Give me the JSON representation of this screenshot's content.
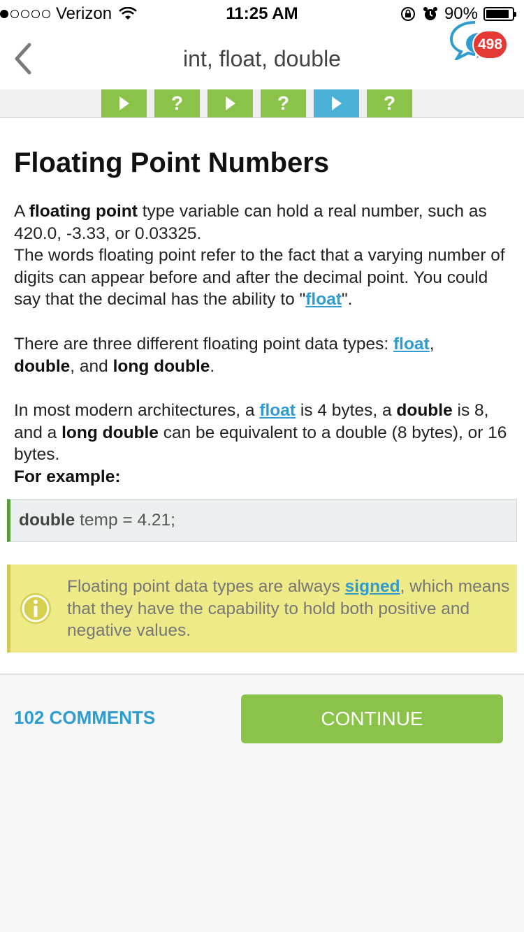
{
  "status_bar": {
    "carrier": "Verizon",
    "time": "11:25 AM",
    "battery": "90%",
    "battery_level": 0.9,
    "signal_dots_filled": 1,
    "signal_dots_total": 5,
    "icons": [
      "signal-dots-icon",
      "wifi-icon",
      "rotation-lock-icon",
      "alarm-icon",
      "battery-icon"
    ]
  },
  "nav": {
    "title": "int, float, double",
    "back_icon": "chevron-left-icon",
    "chat_icon": "chat-bubbles-icon",
    "badge_count": "498"
  },
  "progress_steps": [
    {
      "type": "play",
      "state": "done",
      "glyph": ""
    },
    {
      "type": "quiz",
      "state": "done",
      "glyph": "?"
    },
    {
      "type": "play",
      "state": "done",
      "glyph": ""
    },
    {
      "type": "quiz",
      "state": "done",
      "glyph": "?"
    },
    {
      "type": "play",
      "state": "current",
      "glyph": ""
    },
    {
      "type": "quiz",
      "state": "done",
      "glyph": "?"
    }
  ],
  "lesson": {
    "heading": "Floating Point Numbers",
    "p1": {
      "t1": "A ",
      "b1": "floating point",
      "t2": " type variable can hold a real number, such as 420.0, -3.33, or 0.03325.",
      "t3": "The words floating point refer to the fact that a varying number of digits can appear before and after the decimal point. You could say that the decimal has the ability to \"",
      "link": "float",
      "t4": "\"."
    },
    "p2": {
      "t1": "There are three different floating point data types: ",
      "link": "float",
      "t2": ",",
      "b1": "double",
      "t3": ", and ",
      "b2": "long double",
      "t4": "."
    },
    "p3": {
      "t1": "In most modern architectures, a ",
      "link": "float",
      "t2": " is 4 bytes, a ",
      "b1": "double",
      "t3": " is 8, and a ",
      "b2": "long double",
      "t4": " can be equivalent to a double (8 bytes), or 16 bytes.",
      "example_label": "For example:"
    },
    "code": {
      "keyword": "double",
      "rest": " temp = 4.21;"
    },
    "note": {
      "icon": "info-icon",
      "t1": "Floating point data types are always ",
      "link": "signed",
      "t2": ", which means that they have the capability to hold both positive and negative values."
    }
  },
  "footer": {
    "comments_label": "102 COMMENTS",
    "continue_label": "CONTINUE"
  },
  "colors": {
    "accent_green": "#8bc34a",
    "accent_blue": "#4cb1d6",
    "link_blue": "#2e9bd1",
    "badge_red": "#e53935",
    "note_yellow": "#eeea88"
  }
}
